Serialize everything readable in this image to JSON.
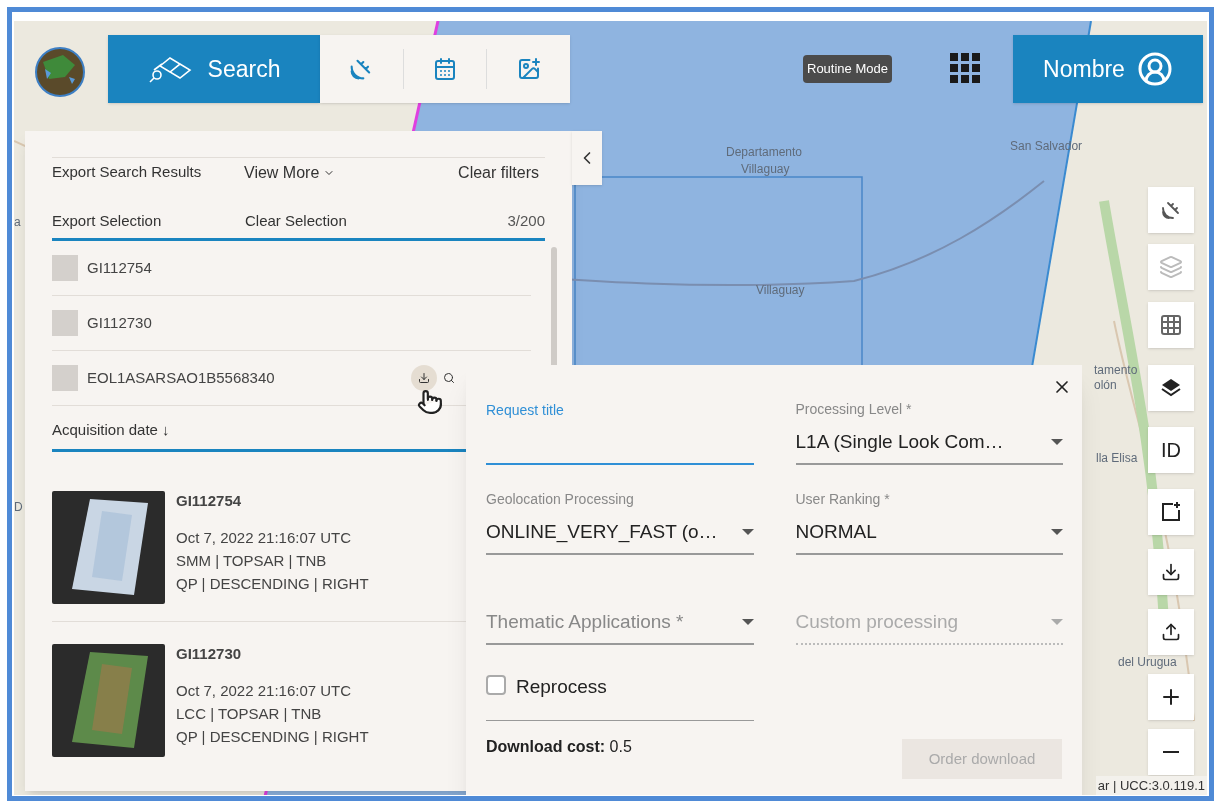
{
  "header": {
    "search_button": "Search",
    "mode_badge": "Routine Mode",
    "user_button": "Nombre"
  },
  "map_labels": [
    "Departamento",
    "Villaguay",
    "Villaguay",
    "San Salvador",
    "tamento",
    "olón",
    "lla Elisa",
    "del Urugua",
    "a",
    "D"
  ],
  "results_panel": {
    "actions": [
      "Export Search Results",
      "View More",
      "Clear filters"
    ],
    "selection_actions": [
      "Export Selection",
      "Clear Selection"
    ],
    "count": "3/200",
    "selection": [
      {
        "name": "GI112754",
        "hovered": false
      },
      {
        "name": "GI112730",
        "hovered": false
      },
      {
        "name": "EOL1ASARSAO1B5568340",
        "hovered": true
      }
    ],
    "sort": "Acquisition date ↓",
    "results": [
      {
        "id": "GI112754",
        "date": "Oct 7, 2022 21:16:07 UTC",
        "line_1": "SMM | TOPSAR | TNB",
        "line_2": "QP | DESCENDING | RIGHT"
      },
      {
        "id": "GI112730",
        "date": "Oct 7, 2022 21:16:07 UTC",
        "line_1": "LCC | TOPSAR | TNB",
        "line_2": "QP | DESCENDING | RIGHT"
      }
    ]
  },
  "order_dialog": {
    "fields": [
      {
        "kind": "text",
        "label": "Request title",
        "focused": true
      },
      {
        "kind": "select",
        "label": "Processing Level *",
        "value": "L1A (Single Look Com…",
        "disabled": false
      },
      {
        "kind": "select",
        "label": "Geolocation Processing",
        "value": "ONLINE_VERY_FAST (o…",
        "disabled": false
      },
      {
        "kind": "select",
        "label": "User Ranking *",
        "value": "NORMAL",
        "disabled": false
      },
      {
        "kind": "select",
        "placeholder": "Thematic Applications *",
        "disabled": false
      },
      {
        "kind": "select",
        "placeholder": "Custom processing",
        "disabled": true
      }
    ],
    "reprocess": {
      "label": "Reprocess",
      "checked": false
    },
    "cost_label": "Download cost:",
    "cost_value": "0.5",
    "order_button": {
      "label": "Order download",
      "disabled": true
    }
  },
  "map_tools": [
    {
      "kind": "satellite"
    },
    {
      "kind": "layers-outline"
    },
    {
      "kind": "grid"
    },
    {
      "kind": "layers"
    },
    {
      "kind": "text",
      "label": "ID"
    },
    {
      "kind": "add-area"
    },
    {
      "kind": "download"
    },
    {
      "kind": "upload"
    },
    {
      "kind": "zoom-in"
    },
    {
      "kind": "zoom-out"
    }
  ],
  "attribution": "ar | UCC:3.0.119.1"
}
